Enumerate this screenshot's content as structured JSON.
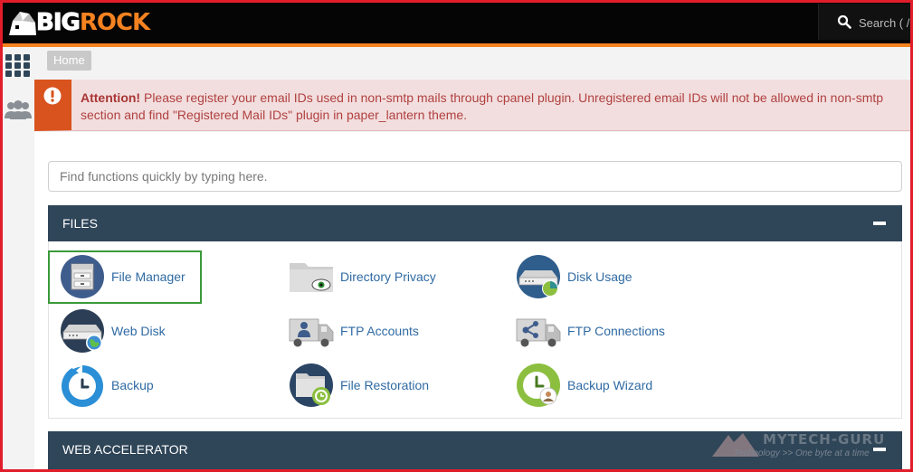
{
  "brand": {
    "logo_big": "BIG",
    "logo_rock": "ROCK",
    "accent": "#f58220"
  },
  "search": {
    "placeholder": "Search ( / )"
  },
  "breadcrumb": {
    "home": "Home"
  },
  "alert": {
    "title": "Attention!",
    "line1": "Please register your email IDs used in non-smtp mails through cpanel plugin. Unregistered email IDs will not be allowed in non-smtp",
    "line2": "section and find \"Registered Mail IDs\" plugin in paper_lantern theme."
  },
  "quick_find": {
    "placeholder": "Find functions quickly by typing here."
  },
  "sections": {
    "files": {
      "title": "FILES",
      "items": [
        {
          "label": "File Manager",
          "icon": "file-manager-icon"
        },
        {
          "label": "Directory Privacy",
          "icon": "directory-privacy-icon"
        },
        {
          "label": "Disk Usage",
          "icon": "disk-usage-icon"
        },
        {
          "label": "Web Disk",
          "icon": "web-disk-icon"
        },
        {
          "label": "FTP Accounts",
          "icon": "ftp-accounts-icon"
        },
        {
          "label": "FTP Connections",
          "icon": "ftp-connections-icon"
        },
        {
          "label": "Backup",
          "icon": "backup-icon"
        },
        {
          "label": "File Restoration",
          "icon": "file-restoration-icon"
        },
        {
          "label": "Backup Wizard",
          "icon": "backup-wizard-icon"
        }
      ]
    },
    "web_accelerator": {
      "title": "WEB ACCELERATOR"
    }
  },
  "watermark": {
    "name": "MYTECH-GURU",
    "tagline": "Technology >> One byte at a time"
  }
}
